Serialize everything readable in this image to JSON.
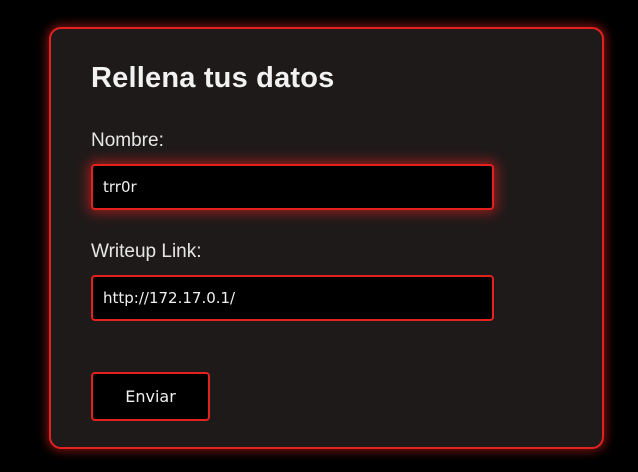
{
  "form": {
    "title": "Rellena tus datos",
    "name_label": "Nombre:",
    "name_value": "trr0r",
    "link_label": "Writeup Link:",
    "link_value": "http://172.17.0.1/",
    "submit_label": "Enviar"
  },
  "colors": {
    "background": "#000000",
    "card": "#1f1a1a",
    "accent": "#e3211f",
    "text": "#f2f2f2"
  }
}
